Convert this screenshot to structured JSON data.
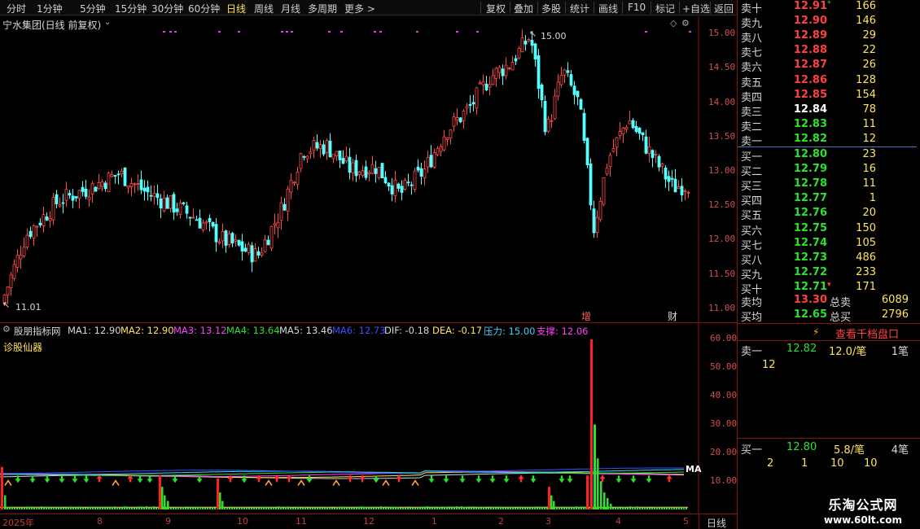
{
  "toolbar": {
    "periods": [
      "分时",
      "1分钟",
      "5分钟",
      "15分钟",
      "30分钟",
      "60分钟",
      "日线",
      "周线",
      "月线",
      "多周期",
      "更多 >"
    ],
    "active_period": "日线",
    "actions": [
      "复权",
      "叠加",
      "多股",
      "统计",
      "画线",
      "F10",
      "标记",
      "+自选",
      "返回"
    ]
  },
  "main_chart": {
    "title": "宁水集团(日线 前复权)",
    "high_label": "15.00",
    "low_label": "11.01",
    "price_ticks": [
      "15.00",
      "14.50",
      "14.00",
      "13.50",
      "13.00",
      "12.50",
      "12.00",
      "11.50",
      "11.00"
    ],
    "tag_zeng": "增",
    "tag_cai": "财"
  },
  "chart_data": {
    "type": "candlestick",
    "ylim": [
      11.0,
      15.0
    ],
    "date_labels": [
      "2025年",
      "8",
      "9",
      "10",
      "11",
      "12",
      "1",
      "2",
      "3",
      "4",
      "5"
    ],
    "high": 15.0,
    "low": 11.01,
    "indicator_ylim": [
      0,
      60
    ],
    "indicator_ticks": [
      "60.00",
      "50.00",
      "40.00",
      "30.00",
      "20.00",
      "10.00"
    ],
    "volume_spike_value": 60
  },
  "indicator": {
    "name": "股朋指标网",
    "sub_name": "诊股仙器",
    "items": [
      {
        "label": "MA1: 12.90",
        "color": "#d8d8d8"
      },
      {
        "label": "MA2: 12.90",
        "color": "#ffe35a"
      },
      {
        "label": "MA3: 13.12",
        "color": "#ff40ff"
      },
      {
        "label": "MA4: 13.64",
        "color": "#2ee02e"
      },
      {
        "label": "MA5: 13.46",
        "color": "#d8d8d8"
      },
      {
        "label": "MA6: 12.73",
        "color": "#3a50ff"
      },
      {
        "label": "DIF: -0.18",
        "color": "#d8d8d8"
      },
      {
        "label": "DEA: -0.17",
        "color": "#ffe35a"
      },
      {
        "label": "压力: 15.00",
        "color": "#40d0ff"
      },
      {
        "label": "支撑: 12.06",
        "color": "#ff40ff"
      }
    ],
    "right_tag": "MA"
  },
  "orderbook": {
    "asks": [
      {
        "label": "卖十",
        "price": "12.91",
        "vol": "166",
        "dir": "up",
        "mark": "*"
      },
      {
        "label": "卖九",
        "price": "12.90",
        "vol": "146",
        "dir": "up"
      },
      {
        "label": "卖八",
        "price": "12.89",
        "vol": "29",
        "dir": "up"
      },
      {
        "label": "卖七",
        "price": "12.88",
        "vol": "22",
        "dir": "up"
      },
      {
        "label": "卖六",
        "price": "12.87",
        "vol": "26",
        "dir": "up"
      },
      {
        "label": "卖五",
        "price": "12.86",
        "vol": "128",
        "dir": "up"
      },
      {
        "label": "卖四",
        "price": "12.85",
        "vol": "154",
        "dir": "up"
      },
      {
        "label": "卖三",
        "price": "12.84",
        "vol": "78",
        "dir": "eq"
      },
      {
        "label": "卖二",
        "price": "12.83",
        "vol": "11",
        "dir": "dn"
      },
      {
        "label": "卖一",
        "price": "12.82",
        "vol": "12",
        "dir": "dn"
      }
    ],
    "bids": [
      {
        "label": "买一",
        "price": "12.80",
        "vol": "23",
        "dir": "dn"
      },
      {
        "label": "买二",
        "price": "12.79",
        "vol": "16",
        "dir": "dn"
      },
      {
        "label": "买三",
        "price": "12.78",
        "vol": "11",
        "dir": "dn"
      },
      {
        "label": "买四",
        "price": "12.77",
        "vol": "1",
        "dir": "dn"
      },
      {
        "label": "买五",
        "price": "12.76",
        "vol": "20",
        "dir": "dn"
      },
      {
        "label": "买六",
        "price": "12.75",
        "vol": "150",
        "dir": "dn"
      },
      {
        "label": "买七",
        "price": "12.74",
        "vol": "105",
        "dir": "dn"
      },
      {
        "label": "买八",
        "price": "12.73",
        "vol": "486",
        "dir": "dn"
      },
      {
        "label": "买九",
        "price": "12.72",
        "vol": "233",
        "dir": "dn"
      },
      {
        "label": "买十",
        "price": "12.71",
        "vol": "171",
        "dir": "dn",
        "mark": "▾"
      }
    ],
    "ask_avg_label": "卖均",
    "ask_avg": "13.30",
    "ask_total_label": "总卖",
    "ask_total": "6089",
    "bid_avg_label": "买均",
    "bid_avg": "12.65",
    "bid_total_label": "总买",
    "bid_total": "2796",
    "detail_link": "查看千档盘口",
    "sell1": {
      "label": "卖一",
      "price": "12.82",
      "per": "12.0/笔",
      "count": "1笔",
      "orders": [
        "12"
      ]
    },
    "buy1": {
      "label": "买一",
      "price": "12.80",
      "per": "5.8/笔",
      "count": "4笔",
      "orders": [
        "2",
        "1",
        "10",
        "10"
      ]
    }
  },
  "period_label": "日线",
  "watermark": {
    "name": "乐淘公式网",
    "url": "www.60lt.com"
  }
}
